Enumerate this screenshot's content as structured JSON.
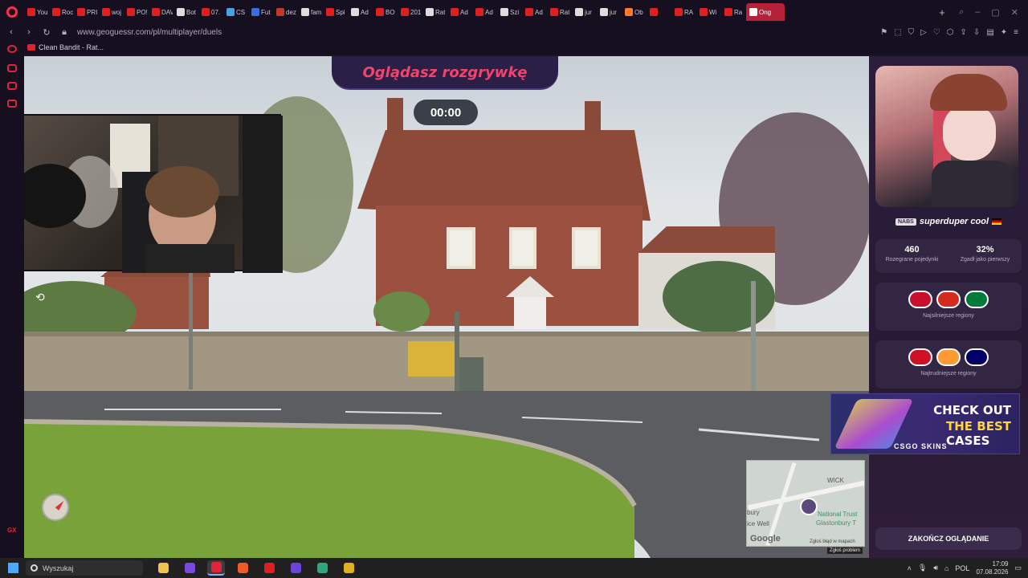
{
  "browser": {
    "tabs": [
      {
        "label": "You",
        "color": "#e02020"
      },
      {
        "label": "Roc",
        "color": "#e02020"
      },
      {
        "label": "PRI",
        "color": "#e02020"
      },
      {
        "label": "woj",
        "color": "#e02020"
      },
      {
        "label": "PO!",
        "color": "#e02020"
      },
      {
        "label": "DAV",
        "color": "#e02020"
      },
      {
        "label": "Bot",
        "color": "#dddddd"
      },
      {
        "label": "07.",
        "color": "#e02020"
      },
      {
        "label": "CS",
        "color": "#4aa0e0"
      },
      {
        "label": "Fut",
        "color": "#3a6ee0"
      },
      {
        "label": "dez",
        "color": "#c0392b"
      },
      {
        "label": "fam",
        "color": "#dddddd"
      },
      {
        "label": "Spi",
        "color": "#e02020"
      },
      {
        "label": "Ad",
        "color": "#dddddd"
      },
      {
        "label": "BO",
        "color": "#e02020"
      },
      {
        "label": "201",
        "color": "#e02020"
      },
      {
        "label": "Rat",
        "color": "#dddddd"
      },
      {
        "label": "Ad",
        "color": "#e02020"
      },
      {
        "label": "Ad",
        "color": "#e02020"
      },
      {
        "label": "Szi",
        "color": "#dddddd"
      },
      {
        "label": "Ad",
        "color": "#e02020"
      },
      {
        "label": "Rat",
        "color": "#e02020"
      },
      {
        "label": "jur",
        "color": "#dddddd"
      },
      {
        "label": "jur",
        "color": "#dddddd"
      },
      {
        "label": "Ob",
        "color": "#ff7a2a"
      },
      {
        "label": "",
        "color": "#e02020"
      },
      {
        "label": "RA",
        "color": "#e02020"
      },
      {
        "label": "Wi",
        "color": "#e02020"
      },
      {
        "label": "Ra",
        "color": "#e02020"
      }
    ],
    "active_tab": {
      "label": "Ong",
      "color": "#ffffff"
    },
    "url": "www.geoguessr.com/pl/multiplayer/duels",
    "bookmark": "Clean Bandit - Rat..."
  },
  "sidebar": {
    "footer": "GX"
  },
  "game": {
    "banner": "Oglądasz rozgrywkę",
    "timer": "00:00",
    "minimap": {
      "labels": [
        "WICK",
        "bury",
        "ice Well",
        "National Trust",
        "Glastonbury T"
      ],
      "google": "Google",
      "report": "Zgłoś błąd w mapach"
    },
    "report_problem": "Zgłoś problem"
  },
  "panel": {
    "player": {
      "tag": "NABS",
      "name": "superduper cool"
    },
    "stats": [
      {
        "value": "460",
        "label": "Rozegrane pojedynki"
      },
      {
        "value": "32%",
        "label": "Zgadł jako pierwszy"
      }
    ],
    "strongest": {
      "label": "Najsilniejsze regiony",
      "flags": [
        {
          "name": "denmark-flag",
          "color": "#c8102e"
        },
        {
          "name": "chile-flag",
          "color": "#d52b1e"
        },
        {
          "name": "jordan-flag",
          "color": "#007a3d"
        }
      ]
    },
    "weakest": {
      "label": "Najtrudniejsze regiony",
      "flags": [
        {
          "name": "indonesia-flag",
          "color": "#ce1126"
        },
        {
          "name": "india-flag",
          "color": "#ff9933"
        },
        {
          "name": "malaysia-flag",
          "color": "#010066"
        }
      ]
    },
    "ad": {
      "line1": "CHECK OUT",
      "line2": "THE BEST",
      "line3": "CASES",
      "brand": "CSGO SKINS"
    },
    "stop_button": "ZAKOŃCZ OGLĄDANIE"
  },
  "taskbar": {
    "search_placeholder": "Wyszukaj",
    "language": "POL",
    "time": "17:09",
    "date": "07.08.2026",
    "apps": [
      {
        "name": "file-explorer",
        "color": "#f2c14e"
      },
      {
        "name": "app-purple",
        "color": "#7a4ae0"
      },
      {
        "name": "opera-gx",
        "color": "#e0243b"
      },
      {
        "name": "brave",
        "color": "#f05a28"
      },
      {
        "name": "opera",
        "color": "#e02020"
      },
      {
        "name": "app-violet",
        "color": "#6a45d8"
      },
      {
        "name": "app-globe",
        "color": "#2fa77a"
      },
      {
        "name": "chrome",
        "color": "#e2b11b"
      }
    ]
  }
}
